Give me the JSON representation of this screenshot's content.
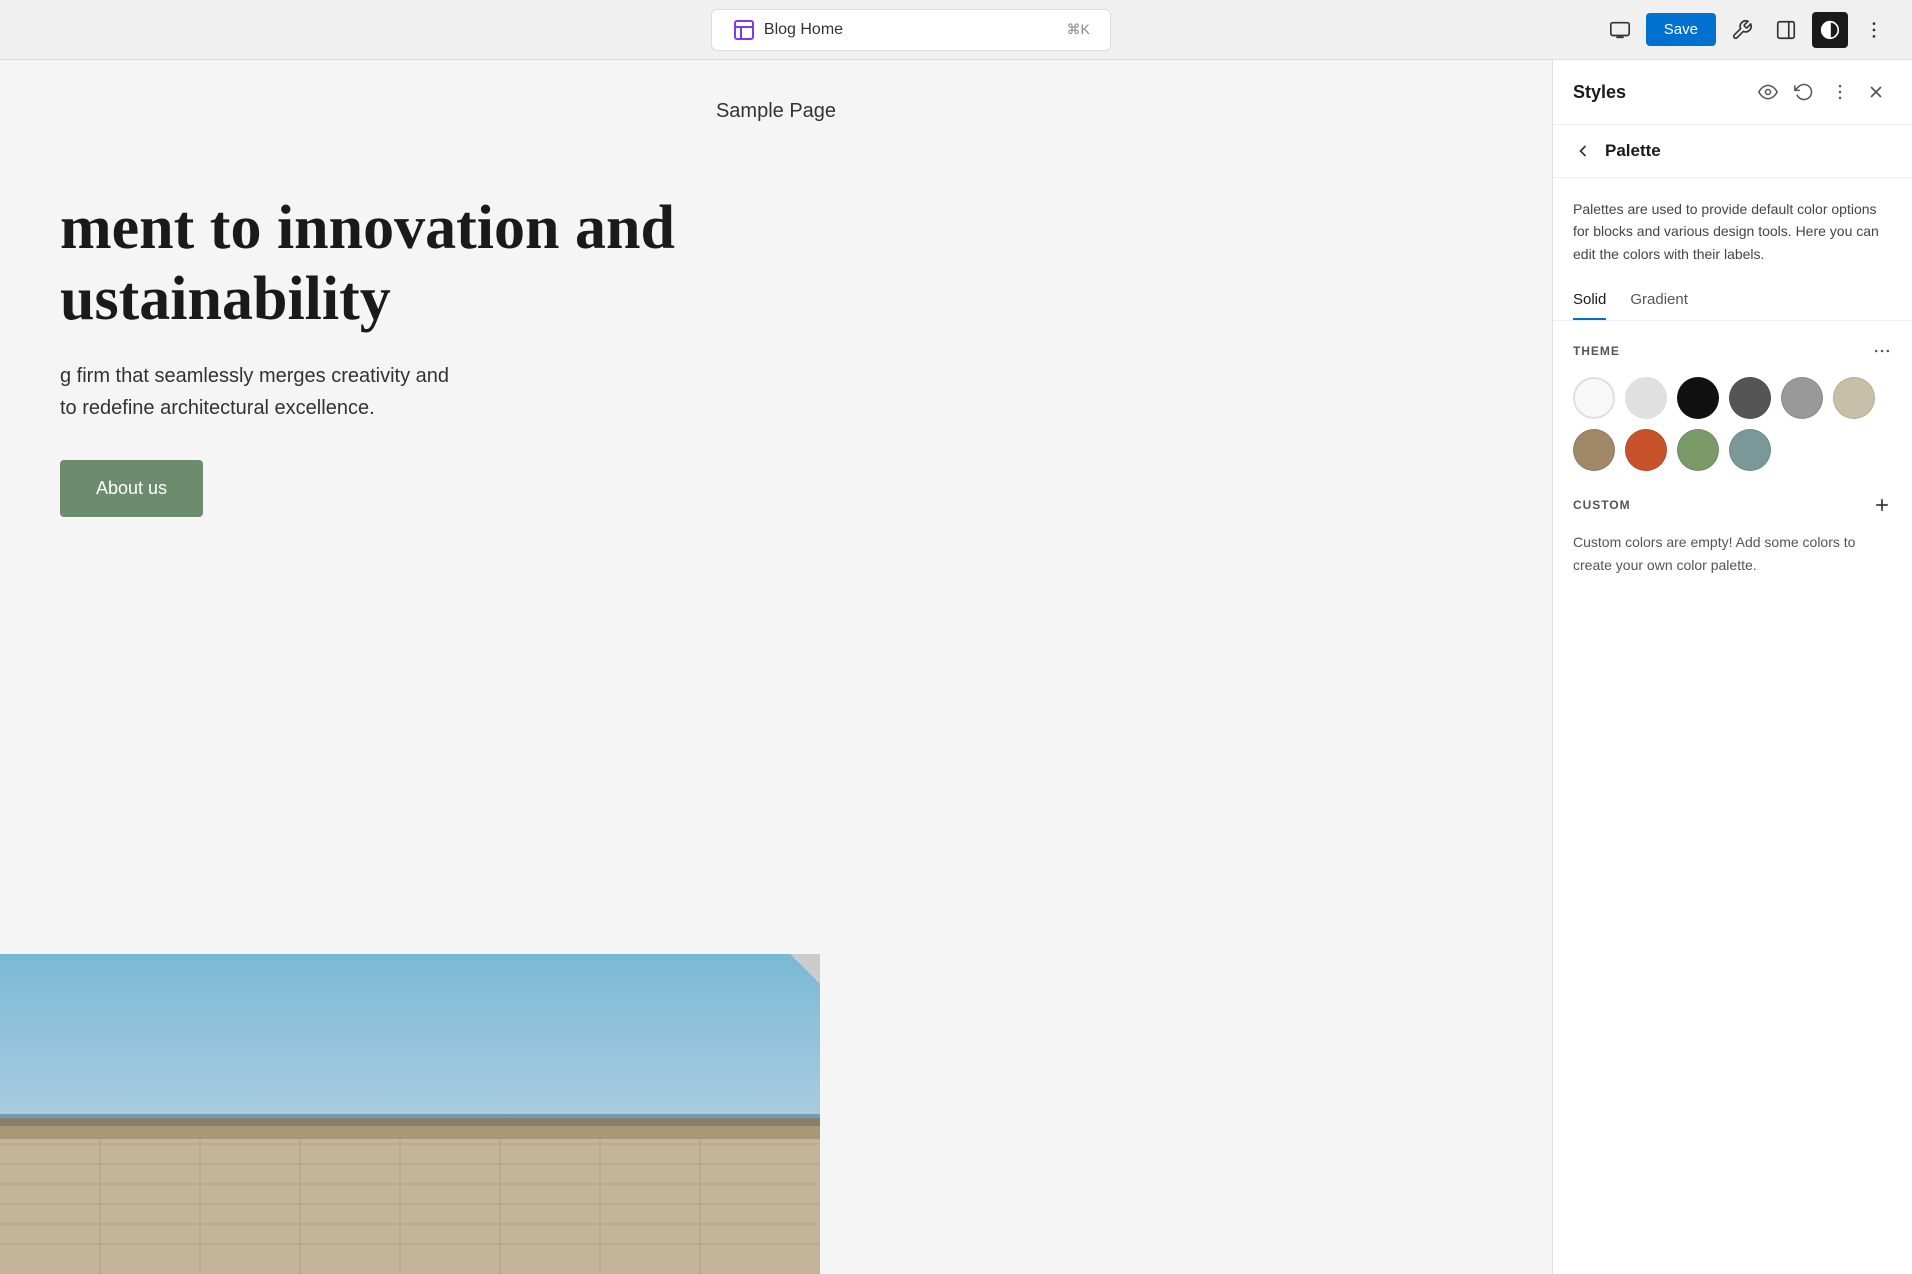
{
  "topbar": {
    "title": "Blog Home",
    "shortcut": "⌘K",
    "save_label": "Save"
  },
  "canvas": {
    "sample_page_title": "Sample Page",
    "hero_heading": "ment to innovation and\nustainability",
    "hero_subtext": "g firm that seamlessly merges creativity and\nto redefine architectural excellence.",
    "about_us_label": "About us"
  },
  "styles_panel": {
    "title": "Styles",
    "palette_title": "Palette",
    "description": "Palettes are used to provide default color options for blocks and various design tools. Here you can edit the colors with their labels.",
    "tabs": [
      {
        "label": "Solid",
        "active": true
      },
      {
        "label": "Gradient",
        "active": false
      }
    ],
    "theme_label": "THEME",
    "theme_colors": [
      {
        "color": "#f8f8f8",
        "name": "white-light",
        "border": true
      },
      {
        "color": "#e8e8e8",
        "name": "white-dark",
        "border": true
      },
      {
        "color": "#111111",
        "name": "black"
      },
      {
        "color": "#555555",
        "name": "dark-gray"
      },
      {
        "color": "#999999",
        "name": "medium-gray"
      },
      {
        "color": "#c8bfa8",
        "name": "warm-beige"
      },
      {
        "color": "#a08868",
        "name": "brown-tan"
      },
      {
        "color": "#c8522a",
        "name": "terracotta"
      },
      {
        "color": "#7a9a6a",
        "name": "sage-green"
      },
      {
        "color": "#7a9898",
        "name": "steel-teal"
      }
    ],
    "custom_label": "CUSTOM",
    "custom_description": "Custom colors are empty! Add some colors to create your own color palette."
  }
}
